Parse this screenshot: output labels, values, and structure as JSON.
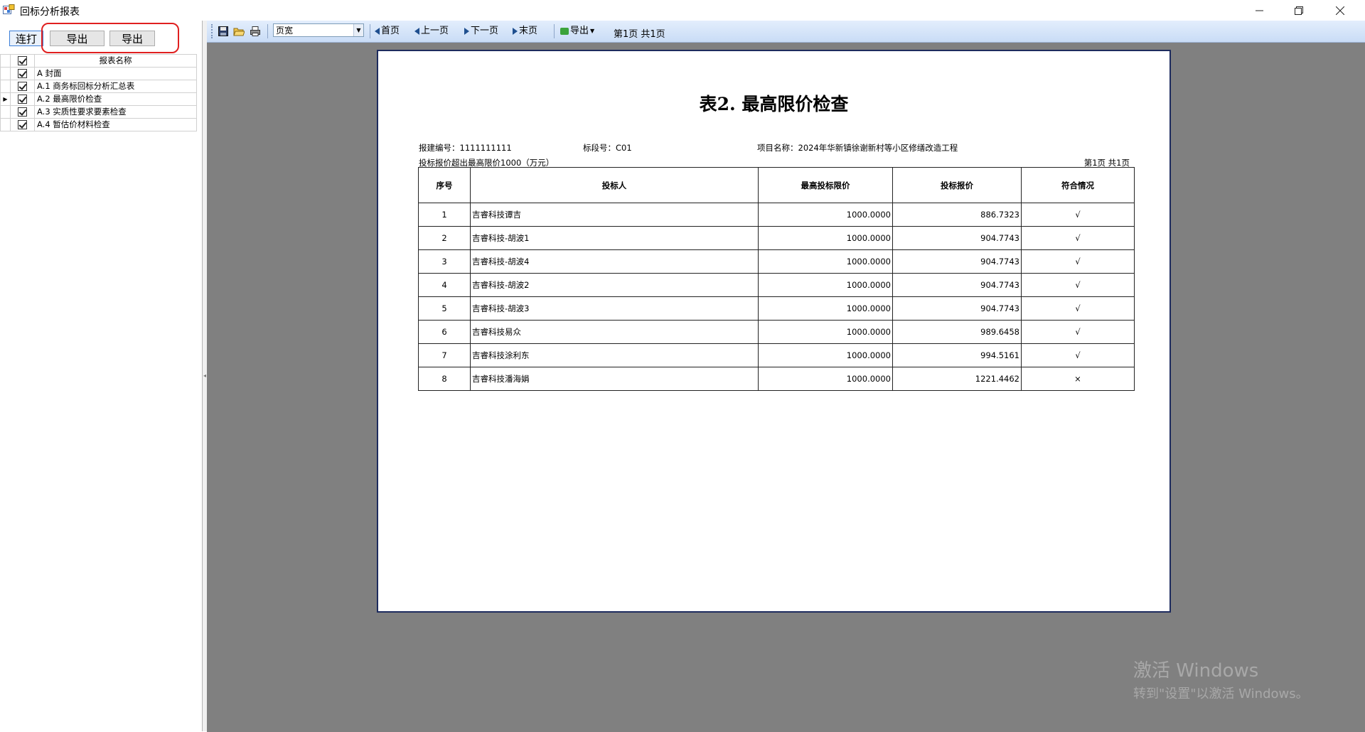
{
  "window": {
    "title": "回标分析报表",
    "controls": [
      "minimize-icon",
      "restore-icon",
      "close-icon"
    ]
  },
  "left_panel": {
    "buttons": {
      "print_all": "连打",
      "export_1": "导出",
      "export_2": "导出"
    },
    "grid": {
      "header": "报表名称",
      "rows": [
        {
          "name": "A 封面",
          "checked": true,
          "current": false
        },
        {
          "name": "A.1 商务标回标分析汇总表",
          "checked": true,
          "current": false
        },
        {
          "name": "A.2 最高限价检查",
          "checked": true,
          "current": true
        },
        {
          "name": "A.3 实质性要求要素检查",
          "checked": true,
          "current": false
        },
        {
          "name": "A.4 暂估价材料检查",
          "checked": true,
          "current": false
        }
      ]
    }
  },
  "toolbar": {
    "icons": [
      "save-icon",
      "open-icon",
      "print-icon"
    ],
    "zoom_value": "页宽",
    "first": "首页",
    "prev": "上一页",
    "next": "下一页",
    "last": "末页",
    "export": "导出",
    "page_info": "第1页 共1页"
  },
  "report": {
    "title": "表2. 最高限价检查",
    "project_no": "报建编号：1111111111",
    "section_no": "标段号：C01",
    "project_name": "项目名称：2024年华新镇徐谢新村等小区修缮改造工程",
    "note": "投标报价超出最高限价1000（万元）",
    "page_label": "第1页 共1页",
    "columns": [
      "序号",
      "投标人",
      "最高投标限价",
      "投标报价",
      "符合情况"
    ],
    "rows": [
      [
        "1",
        "吉睿科技谭吉",
        "1000.0000",
        "886.7323",
        "√"
      ],
      [
        "2",
        "吉睿科技-胡波1",
        "1000.0000",
        "904.7743",
        "√"
      ],
      [
        "3",
        "吉睿科技-胡波4",
        "1000.0000",
        "904.7743",
        "√"
      ],
      [
        "4",
        "吉睿科技-胡波2",
        "1000.0000",
        "904.7743",
        "√"
      ],
      [
        "5",
        "吉睿科技-胡波3",
        "1000.0000",
        "904.7743",
        "√"
      ],
      [
        "6",
        "吉睿科技易众",
        "1000.0000",
        "989.6458",
        "√"
      ],
      [
        "7",
        "吉睿科技涂利东",
        "1000.0000",
        "994.5161",
        "√"
      ],
      [
        "8",
        "吉睿科技潘海娟",
        "1000.0000",
        "1221.4462",
        "×"
      ]
    ]
  },
  "watermark": {
    "line1": "激活 Windows",
    "line2": "转到\"设置\"以激活 Windows。"
  }
}
